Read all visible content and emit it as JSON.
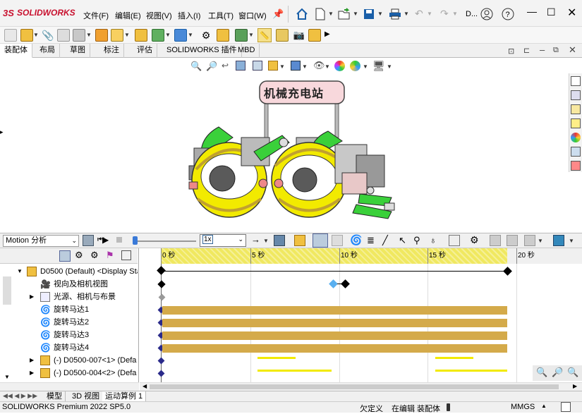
{
  "app": {
    "logo_text": "SOLIDWORKS",
    "status_left": "SOLIDWORKS Premium 2022 SP5.0"
  },
  "menu": [
    {
      "label": "文件(F)"
    },
    {
      "label": "编辑(E)"
    },
    {
      "label": "视图(V)"
    },
    {
      "label": "插入(I)"
    },
    {
      "label": "工具(T)"
    },
    {
      "label": "窗口(W)"
    }
  ],
  "titlebar": {
    "user_initial": "D..."
  },
  "tabs": [
    "装配体",
    "布局",
    "草图",
    "标注",
    "评估",
    "SOLIDWORKS 插件",
    "MBD"
  ],
  "viewport": {
    "sign_text": "机械充电站"
  },
  "motion": {
    "study_type": "Motion 分析",
    "speed": "1x"
  },
  "timeline": {
    "ticks": [
      "0 秒",
      "5 秒",
      "10 秒",
      "15 秒",
      "20 秒"
    ]
  },
  "tree": [
    {
      "label": "D0500 (Default) <Display Sta"
    },
    {
      "label": "视向及相机视图"
    },
    {
      "label": "光源、相机与布景"
    },
    {
      "label": "旋转马达1"
    },
    {
      "label": "旋转马达2"
    },
    {
      "label": "旋转马达3"
    },
    {
      "label": "旋转马达4"
    },
    {
      "label": "(-) D0500-007<1> (Defa"
    },
    {
      "label": "(-) D0500-004<2> (Defa"
    }
  ],
  "bottom_tabs": [
    "模型",
    "3D 视图",
    "运动算例 1"
  ],
  "status": {
    "constraint": "欠定义",
    "editing": "在编辑 装配体",
    "units": "MMGS"
  },
  "colors": {
    "accent_red": "#c8102e",
    "motor_bar": "#d4aa4a",
    "key_yellow": "#f2ea00",
    "timeline_head": "#f0e860"
  }
}
